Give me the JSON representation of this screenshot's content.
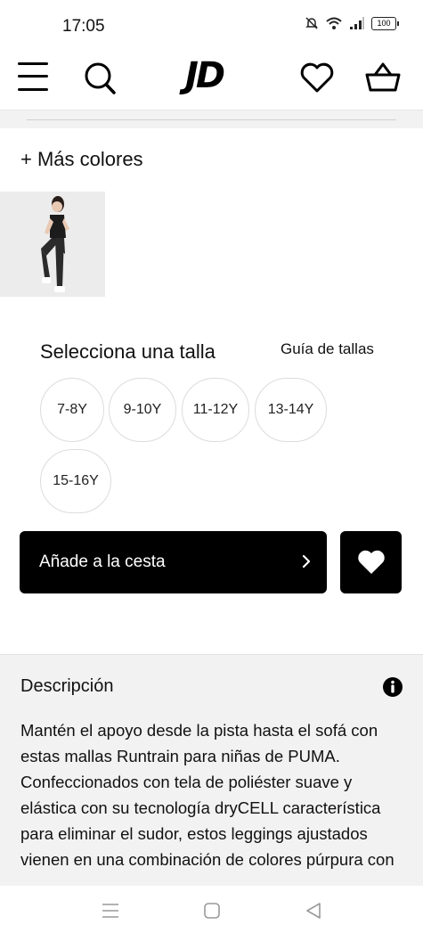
{
  "status_bar": {
    "time": "17:05",
    "battery": "100"
  },
  "header": {
    "logo": "JD",
    "icons": [
      "menu-icon",
      "search-icon",
      "heart-icon",
      "basket-icon"
    ]
  },
  "product": {
    "more_colors_label": "+ Más colores",
    "size_section": {
      "title": "Selecciona una talla",
      "guide_link": "Guía de tallas",
      "sizes": [
        "7-8Y",
        "9-10Y",
        "11-12Y",
        "13-14Y",
        "15-16Y"
      ]
    },
    "add_to_cart_label": "Añade a la cesta"
  },
  "description": {
    "title": "Descripción",
    "text": "Mantén el apoyo desde la pista hasta el sofá con estas mallas Runtrain para niñas de PUMA. Confeccionados con tela de poliéster suave y elástica con su tecnología dryCELL característica para eliminar el sudor, estos leggings ajustados vienen en una combinación de colores púrpura con"
  },
  "colors": {
    "accent": "#000000",
    "panel_bg": "#f2f2f2",
    "border": "#dcdcdc"
  }
}
